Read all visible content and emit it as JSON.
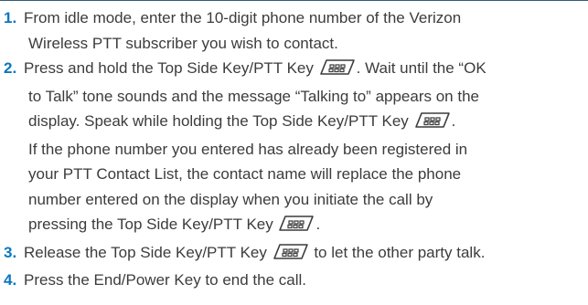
{
  "steps": [
    {
      "number": "1.",
      "line1": "From idle mode, enter the 10-digit phone number of the Verizon",
      "line2": "Wireless PTT subscriber you wish to contact."
    },
    {
      "number": "2.",
      "line1": "Press and hold the Top Side Key/PTT Key",
      "line1_end": ". Wait until the “OK",
      "line2": "to Talk” tone sounds and the message “Talking to” appears on the",
      "line3": "display. Speak while holding the Top Side Key/PTT Key",
      "line3_end": ".",
      "line4": "If the phone number you entered has already been registered in",
      "line5": "your PTT Contact List, the contact name will replace the phone",
      "line6": "number entered on the display when you initiate the call by",
      "line7": "pressing the Top Side Key/PTT Key",
      "line7_end": "."
    },
    {
      "number": "3.",
      "line1": "Release the Top Side Key/PTT Key",
      "line1_end": " to let the other party talk."
    },
    {
      "number": "4.",
      "line1": "Press the End/Power Key to end the call."
    }
  ],
  "icons": {
    "ptt_key": "ptt-key-icon"
  },
  "colors": {
    "step_number": "#0b77c0",
    "body_text": "#3c3c3c",
    "top_rule": "#2f5f7a"
  }
}
